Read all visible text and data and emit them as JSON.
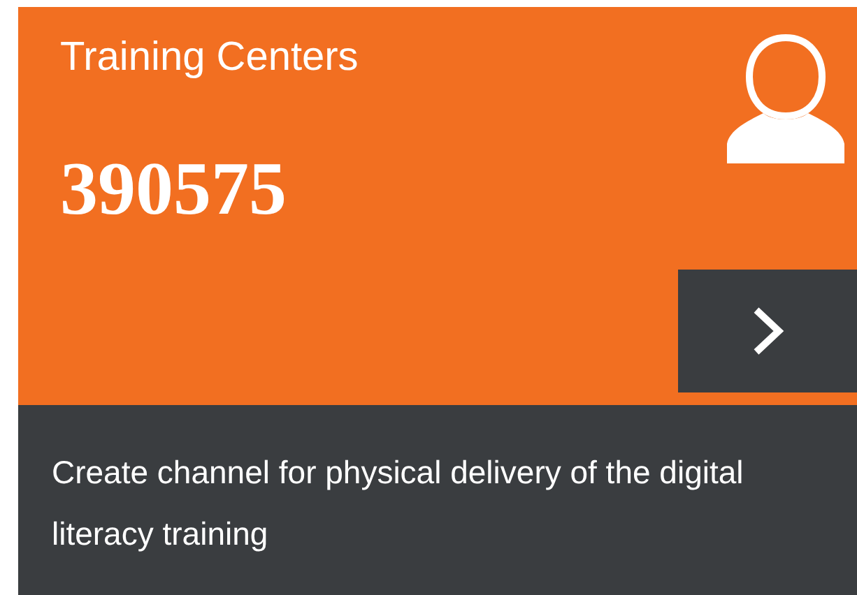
{
  "card": {
    "title": "Training Centers",
    "count": "390575",
    "description": "Create channel for physical delivery of the digital literacy training"
  }
}
